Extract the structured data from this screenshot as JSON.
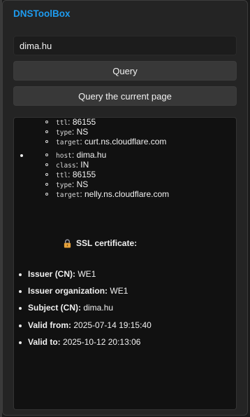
{
  "app": {
    "title": "DNSToolBox"
  },
  "domain_input": {
    "value": "dima.hu"
  },
  "buttons": {
    "query": "Query",
    "query_current": "Query the current page"
  },
  "results": {
    "ns_records": [
      {
        "ttl_label": "ttl",
        "ttl": "86155",
        "type_label": "type",
        "type": "NS",
        "target_label": "target",
        "target": "curt.ns.cloudflare.com"
      },
      {
        "host_label": "host",
        "host": "dima.hu",
        "class_label": "class",
        "class": "IN",
        "ttl_label": "ttl",
        "ttl": "86155",
        "type_label": "type",
        "type": "NS",
        "target_label": "target",
        "target": "nelly.ns.cloudflare.com"
      }
    ],
    "ssl": {
      "icon": "lock-icon",
      "heading": "SSL certificate:",
      "items": [
        {
          "label": "Issuer (CN):",
          "value": "WE1"
        },
        {
          "label": "Issuer organization:",
          "value": "WE1"
        },
        {
          "label": "Subject (CN):",
          "value": "dima.hu"
        },
        {
          "label": "Valid from:",
          "value": "2025-07-14 19:15:40"
        },
        {
          "label": "Valid to:",
          "value": "2025-10-12 20:13:06"
        }
      ]
    }
  }
}
